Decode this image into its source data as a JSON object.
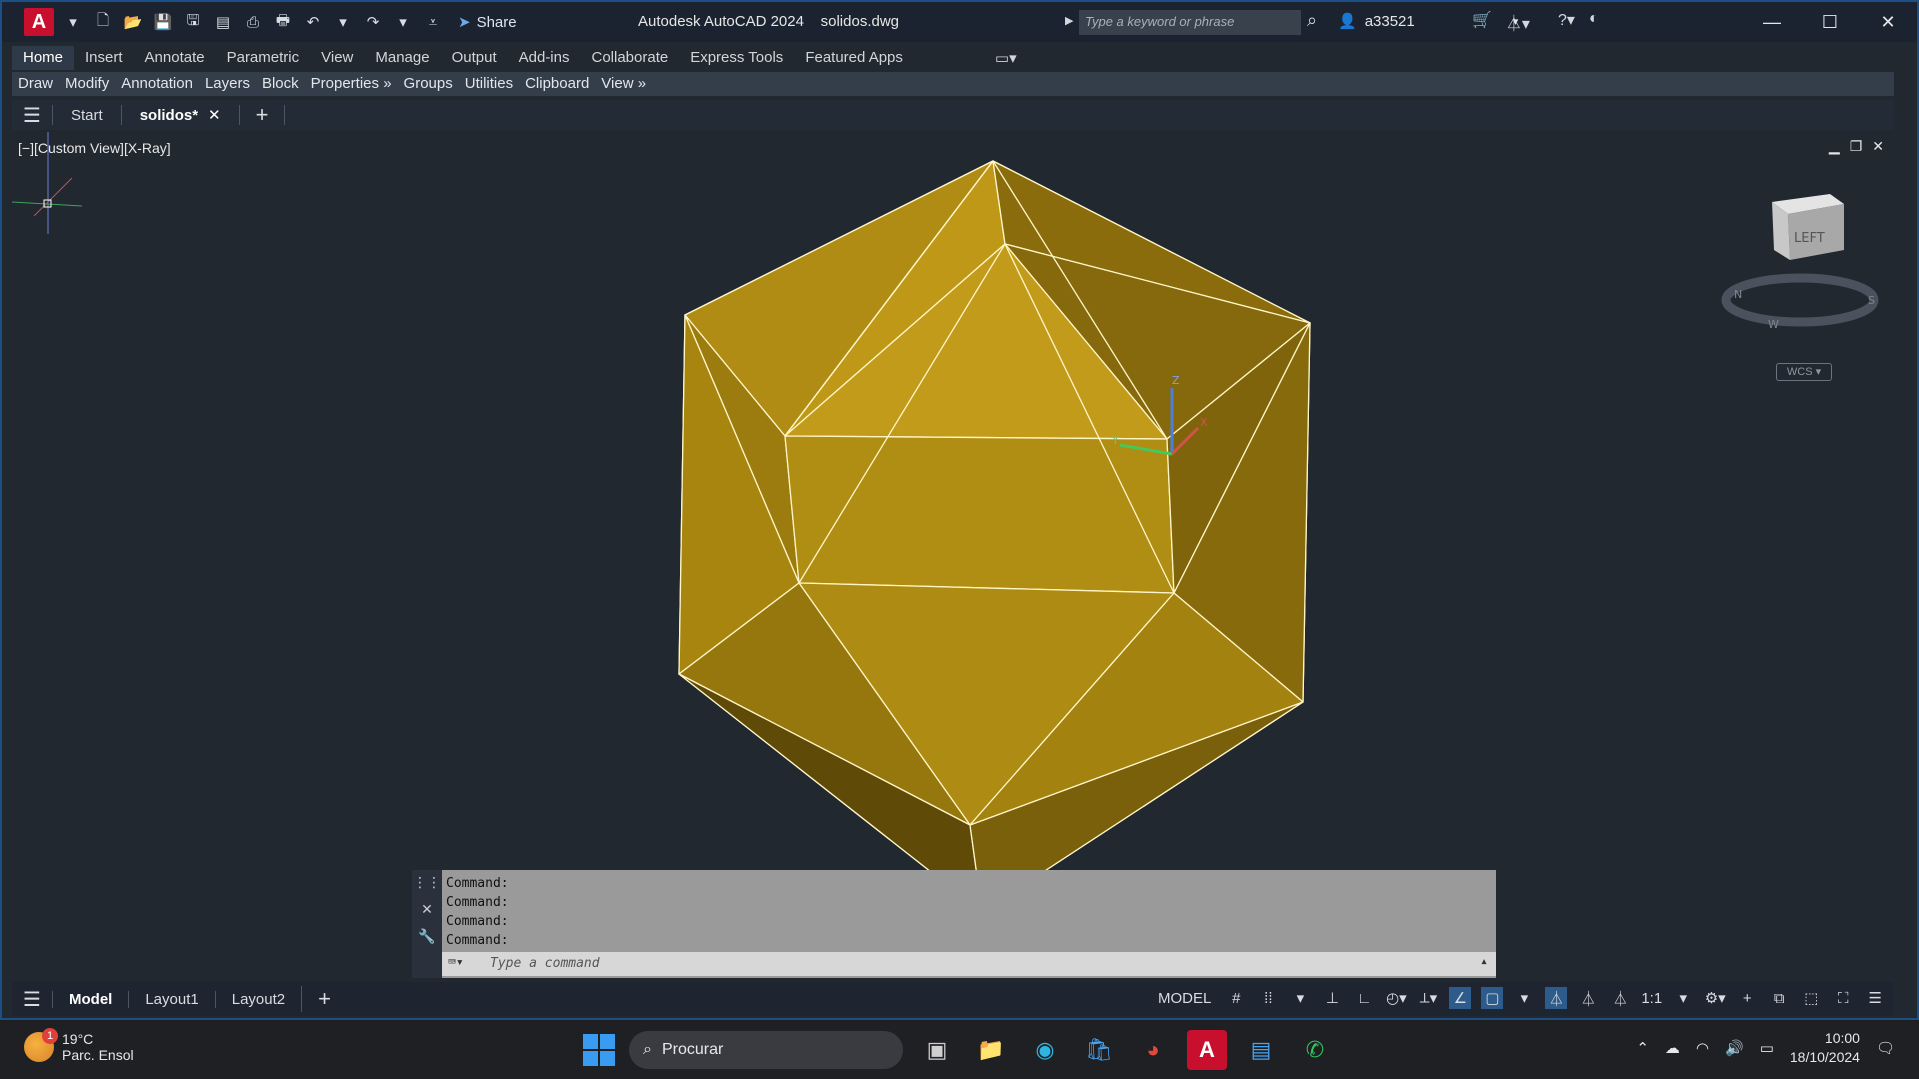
{
  "titlebar": {
    "title_app": "Autodesk AutoCAD 2024",
    "title_file": "solidos.dwg",
    "share_label": "Share",
    "search_placeholder": "Type a keyword or phrase",
    "user": "a33521",
    "logo_letter": "A"
  },
  "ribbon": {
    "tabs": [
      "Home",
      "Insert",
      "Annotate",
      "Parametric",
      "View",
      "Manage",
      "Output",
      "Add-ins",
      "Collaborate",
      "Express Tools",
      "Featured Apps"
    ],
    "panels": [
      "Draw",
      "Modify",
      "Annotation",
      "Layers",
      "Block",
      "Properties »",
      "Groups",
      "Utilities",
      "Clipboard",
      "View »"
    ]
  },
  "doc_tabs": {
    "start": "Start",
    "active": "solidos*"
  },
  "viewport": {
    "label": "[−][Custom View][X-Ray]",
    "viewcube_face": "LEFT",
    "wcs": "WCS",
    "compass_letters": [
      "N",
      "W",
      "S"
    ],
    "ucs_labels": [
      "Z",
      "Y",
      "X"
    ],
    "shape_fill": "#b89211",
    "edge_color": "#fff6c8"
  },
  "command": {
    "history": [
      "Command:",
      "Command:",
      "Command:",
      "Command:"
    ],
    "placeholder": "Type a command"
  },
  "status": {
    "layouts": [
      "Model",
      "Layout1",
      "Layout2"
    ],
    "mode": "MODEL",
    "scale": "1:1"
  },
  "taskbar": {
    "temp": "19°C",
    "weather_desc": "Parc. Ensol",
    "weather_badge": "1",
    "search": "Procurar",
    "time": "10:00",
    "date": "18/10/2024"
  }
}
